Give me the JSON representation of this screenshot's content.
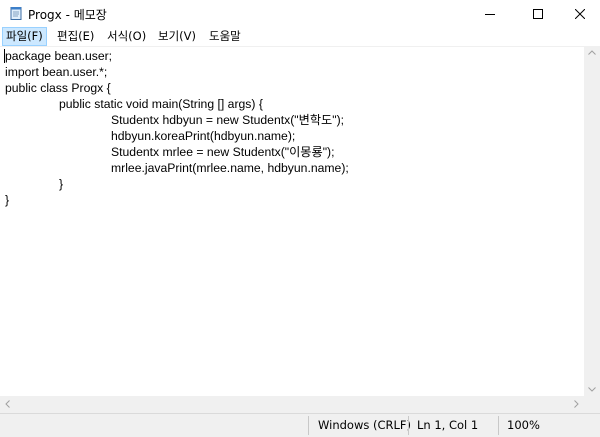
{
  "window": {
    "title": "Progx - 메모장",
    "app_icon": "notepad-icon",
    "controls": [
      "minimize-icon",
      "maximize-icon",
      "close-icon"
    ]
  },
  "menu": {
    "items": [
      {
        "label": "파일(F)"
      },
      {
        "label": "편집(E)"
      },
      {
        "label": "서식(O)"
      },
      {
        "label": "보기(V)"
      },
      {
        "label": "도움말"
      }
    ]
  },
  "editor": {
    "lines": [
      "package bean.user;",
      "import bean.user.*;",
      "public class Progx {",
      "public static void main(String [] args) {",
      "Studentx hdbyun = new Studentx(\"변학도\");",
      "hdbyun.koreaPrint(hdbyun.name);",
      "Studentx mrlee = new Studentx(\"이몽룡\");",
      "mrlee.javaPrint(mrlee.name, hdbyun.name);",
      "}",
      "}"
    ]
  },
  "status": {
    "line_ending": "Windows (CRLF)",
    "position": "Ln 1, Col 1",
    "zoom": "100%"
  },
  "colors": {
    "menu_active_bg": "#cce8ff",
    "chrome_bg": "#f0f0f0"
  }
}
